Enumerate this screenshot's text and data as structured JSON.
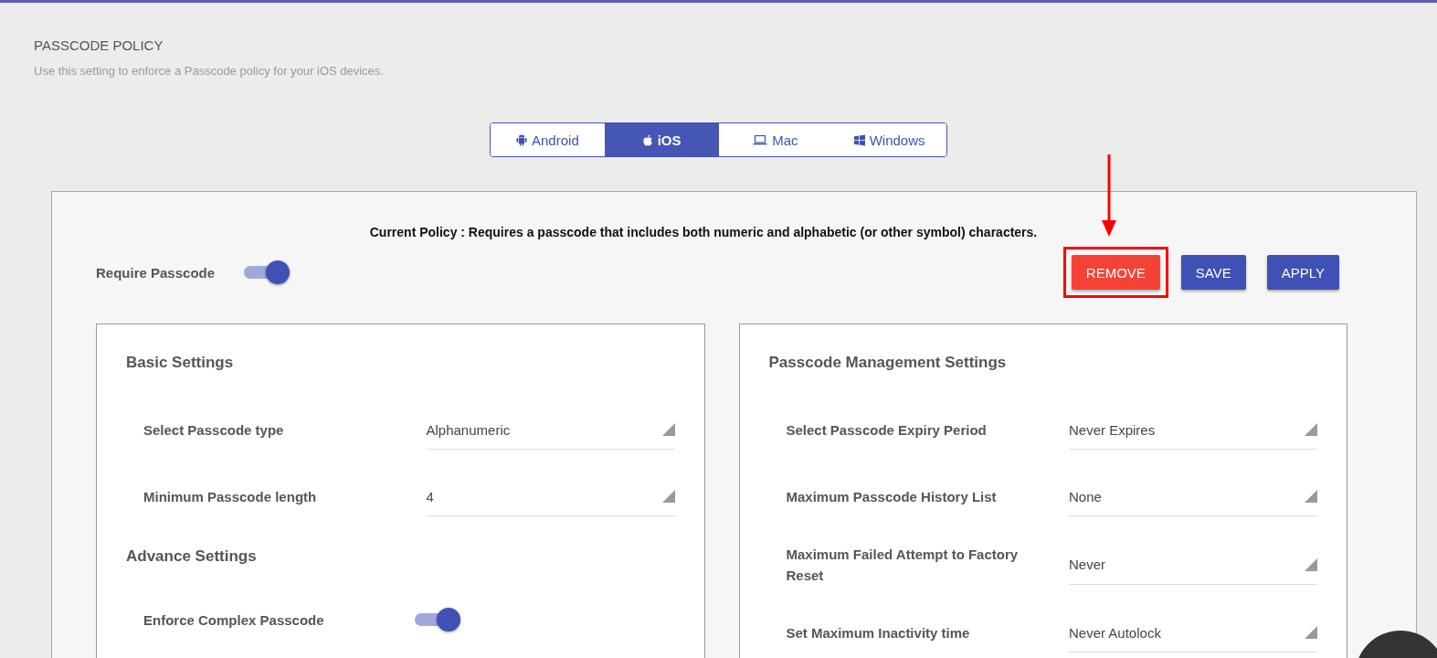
{
  "header": {
    "title": "PASSCODE POLICY",
    "subtitle": "Use this setting to enforce a Passcode policy for your iOS devices."
  },
  "tabs": [
    {
      "label": "Android",
      "selected": false
    },
    {
      "label": "iOS",
      "selected": true
    },
    {
      "label": "Mac",
      "selected": false
    },
    {
      "label": "Windows",
      "selected": false
    }
  ],
  "current_policy": "Current Policy : Requires a passcode that includes both numeric and alphabetic (or other symbol) characters.",
  "require_passcode": {
    "label": "Require Passcode",
    "on": true
  },
  "buttons": [
    {
      "label": "REMOVE",
      "kind": "danger",
      "highlighted": true
    },
    {
      "label": "SAVE",
      "kind": "primary",
      "highlighted": false
    },
    {
      "label": "APPLY",
      "kind": "primary",
      "highlighted": false
    }
  ],
  "left_panel": {
    "sections": [
      {
        "title": "Basic Settings",
        "rows": [
          {
            "kind": "select",
            "label": "Select Passcode type",
            "value": "Alphanumeric"
          },
          {
            "kind": "select",
            "label": "Minimum Passcode length",
            "value": "4"
          }
        ]
      },
      {
        "title": "Advance Settings",
        "rows": [
          {
            "kind": "toggle",
            "label": "Enforce Complex Passcode",
            "on": true
          }
        ]
      }
    ]
  },
  "right_panel": {
    "sections": [
      {
        "title": "Passcode Management Settings",
        "rows": [
          {
            "kind": "select",
            "label": "Select Passcode Expiry Period",
            "value": "Never Expires"
          },
          {
            "kind": "select",
            "label": "Maximum Passcode History List",
            "value": "None"
          },
          {
            "kind": "select",
            "label": "Maximum Failed Attempt to Factory Reset",
            "value": "Never"
          },
          {
            "kind": "select",
            "label": "Set Maximum Inactivity time",
            "value": "Never Autolock"
          }
        ]
      }
    ]
  }
}
